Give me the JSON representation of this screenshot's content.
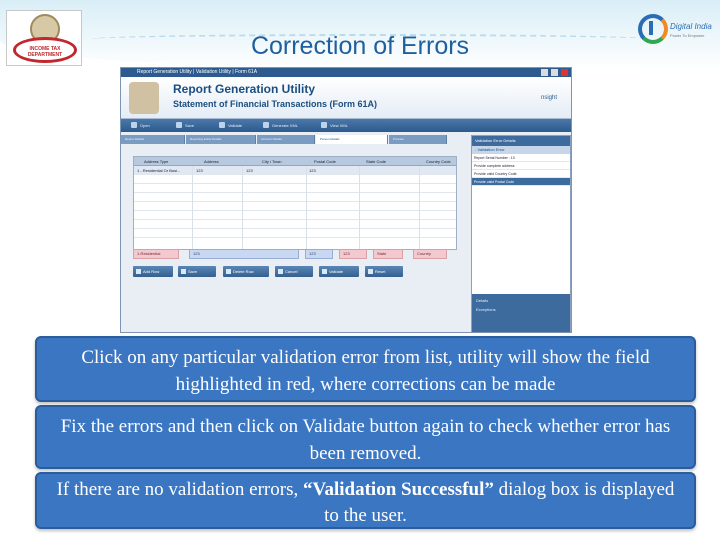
{
  "slide": {
    "title": "Correction of Errors",
    "logo_left_text": "INCOME TAX DEPARTMENT",
    "logo_right_text": "Digital India",
    "logo_right_sub": "Power To Empower"
  },
  "app": {
    "window_title": "Report Generation Utility | Validation Utility | Form 61A",
    "header_title": "Report Generation Utility",
    "header_subtitle": "Statement of Financial Transactions (Form 61A)",
    "brand": "nsight",
    "toolbar": [
      "Open",
      "Save",
      "Validate",
      "Generate XML",
      "View XML"
    ],
    "tabs": [
      "Report Details",
      "Reporting Entity Details",
      "Account Details",
      "Person Details",
      "Preview"
    ],
    "grid": {
      "headers": [
        "Address Type",
        "Address",
        "City / Town",
        "Postal Code",
        "State Code",
        "Country Code"
      ],
      "rows": [
        [
          "1 - Residential Or Busi...",
          "123",
          "123",
          "123",
          "",
          ""
        ]
      ]
    },
    "form_fields": [
      "1-Residential",
      "123",
      "123",
      "123",
      "State",
      "Country"
    ],
    "buttons": [
      "Add Row",
      "Save",
      "Delete Row",
      "Cancel",
      "Validate",
      "Reset"
    ],
    "validation_panel": {
      "title": "Validation Error Details",
      "subtitle": "- Validation Error",
      "items": [
        "Report Serial Number : 13",
        "Provide complete address",
        "Provide valid Country Code",
        "Provide valid Postal Code"
      ],
      "footer": [
        "Details",
        "Exceptions"
      ]
    }
  },
  "callouts": {
    "c1": "Click on any particular validation error from list, utility will show the field highlighted in red, where corrections can be made",
    "c2": "Fix the errors and then click on Validate button again to check whether error has been removed.",
    "c3_pre": "If there are no validation errors, ",
    "c3_bold": "“Validation Successful”",
    "c3_post": " dialog box is displayed to the user."
  }
}
